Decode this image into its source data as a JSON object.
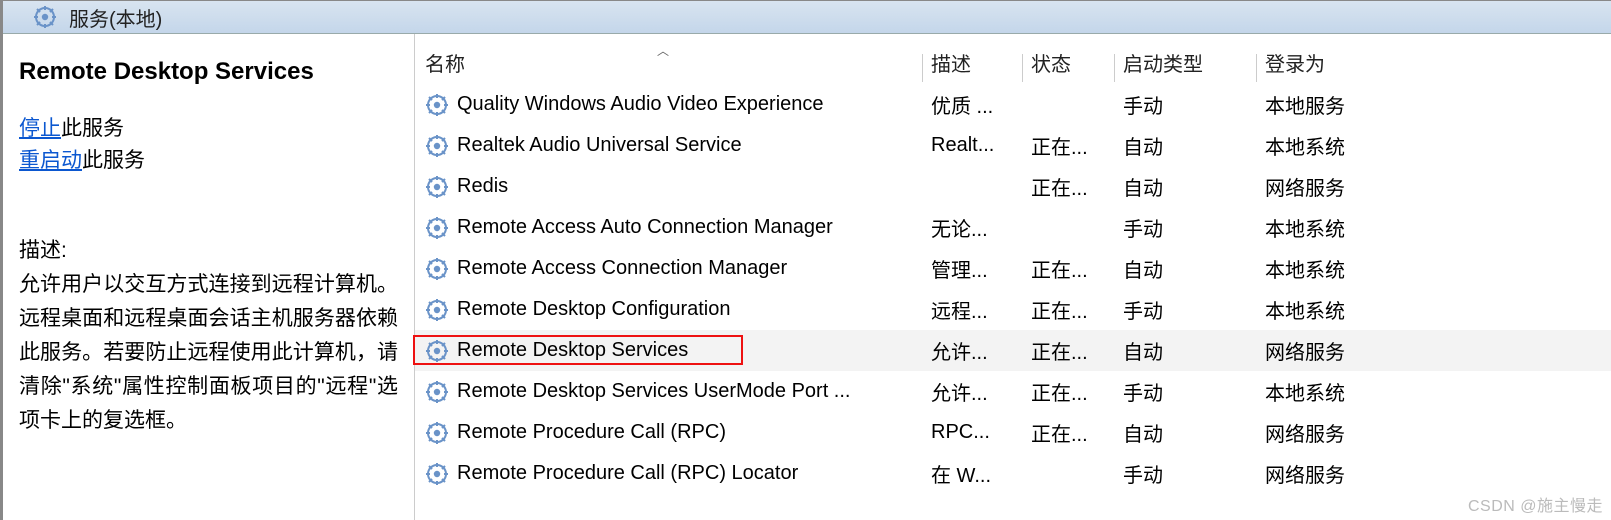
{
  "titlebar": {
    "text": "服务(本地)"
  },
  "left": {
    "title": "Remote Desktop Services",
    "stop_link": "停止",
    "stop_suffix": "此服务",
    "restart_link": "重启动",
    "restart_suffix": "此服务",
    "desc_label": "描述:",
    "desc_body": "允许用户以交互方式连接到远程计算机。远程桌面和远程桌面会话主机服务器依赖此服务。若要防止远程使用此计算机，请清除\"系统\"属性控制面板项目的\"远程\"选项卡上的复选框。"
  },
  "columns": {
    "name": "名称",
    "desc": "描述",
    "status": "状态",
    "start": "启动类型",
    "logon": "登录为"
  },
  "rows": [
    {
      "name": "Quality Windows Audio Video Experience",
      "desc": "优质 ...",
      "status": "",
      "start": "手动",
      "logon": "本地服务",
      "hl": false
    },
    {
      "name": "Realtek Audio Universal Service",
      "desc": "Realt...",
      "status": "正在...",
      "start": "自动",
      "logon": "本地系统",
      "hl": false
    },
    {
      "name": "Redis",
      "desc": "",
      "status": "正在...",
      "start": "自动",
      "logon": "网络服务",
      "hl": false
    },
    {
      "name": "Remote Access Auto Connection Manager",
      "desc": "无论...",
      "status": "",
      "start": "手动",
      "logon": "本地系统",
      "hl": false
    },
    {
      "name": "Remote Access Connection Manager",
      "desc": "管理...",
      "status": "正在...",
      "start": "自动",
      "logon": "本地系统",
      "hl": false
    },
    {
      "name": "Remote Desktop Configuration",
      "desc": "远程...",
      "status": "正在...",
      "start": "手动",
      "logon": "本地系统",
      "hl": false
    },
    {
      "name": "Remote Desktop Services",
      "desc": "允许...",
      "status": "正在...",
      "start": "自动",
      "logon": "网络服务",
      "hl": true
    },
    {
      "name": "Remote Desktop Services UserMode Port ...",
      "desc": "允许...",
      "status": "正在...",
      "start": "手动",
      "logon": "本地系统",
      "hl": false
    },
    {
      "name": "Remote Procedure Call (RPC)",
      "desc": "RPC...",
      "status": "正在...",
      "start": "自动",
      "logon": "网络服务",
      "hl": false
    },
    {
      "name": "Remote Procedure Call (RPC) Locator",
      "desc": "在 W...",
      "status": "",
      "start": "手动",
      "logon": "网络服务",
      "hl": false
    }
  ],
  "highlight_index": 6,
  "watermark": "CSDN @施主慢走"
}
